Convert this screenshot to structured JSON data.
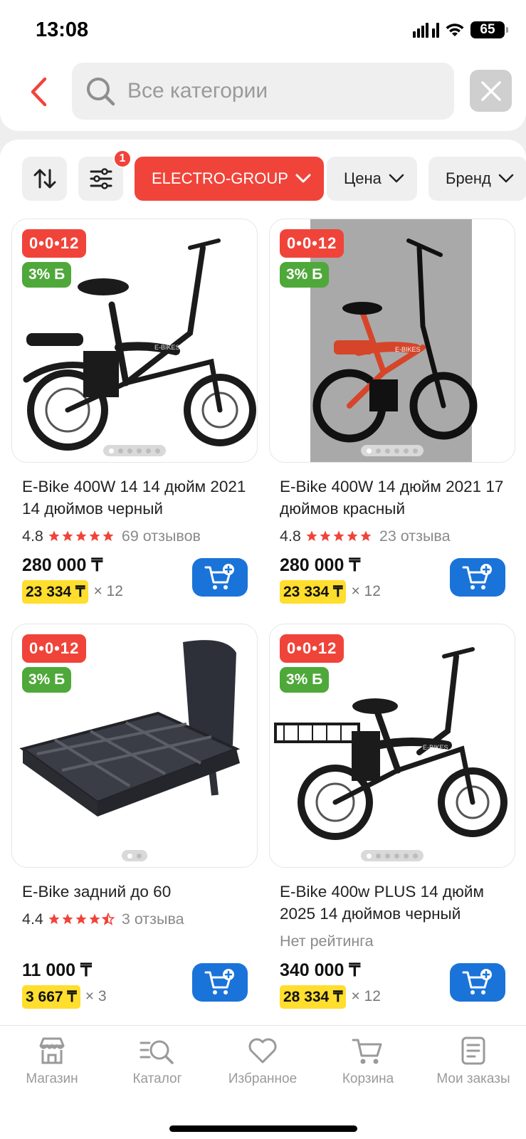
{
  "status": {
    "time": "13:08",
    "battery": "65"
  },
  "search": {
    "placeholder": "Все категории"
  },
  "filters": {
    "sort_badge": "1",
    "chips": [
      "ELECTRO-GROUP",
      "Цена",
      "Бренд"
    ]
  },
  "products": [
    {
      "installment": "0•0•12",
      "bonus": "3% Б",
      "title": "E-Bike 400W 14 14 дюйм 2021 14 дюймов черный",
      "rating": "4.8",
      "stars": 5,
      "reviews": "69 отзывов",
      "price": "280 000 ₸",
      "monthly": "23 334 ₸",
      "months": "× 12",
      "image": "black-folding-ebike",
      "image_dots": 6,
      "active_dot": 0
    },
    {
      "installment": "0•0•12",
      "bonus": "3% Б",
      "title": "E-Bike 400W 14 дюйм 2021 17 дюймов красный",
      "rating": "4.8",
      "stars": 5,
      "reviews": "23 отзыва",
      "price": "280 000 ₸",
      "monthly": "23 334 ₸",
      "months": "× 12",
      "image": "red-folding-ebike",
      "image_dots": 6,
      "active_dot": 0
    },
    {
      "installment": "0•0•12",
      "bonus": "3% Б",
      "title": "E-Bike задний до 60",
      "rating": "4.4",
      "stars": 4.5,
      "reviews": "3 отзыва",
      "price": "11 000 ₸",
      "monthly": "3 667 ₸",
      "months": "× 3",
      "image": "rear-rack-with-backrest",
      "image_dots": 2,
      "active_dot": 0
    },
    {
      "installment": "0•0•12",
      "bonus": "3% Б",
      "title": "E-Bike 400w PLUS 14 дюйм 2025 14 дюймов черный",
      "no_rating": "Нет рейтинга",
      "price": "340 000 ₸",
      "monthly": "28 334 ₸",
      "months": "× 12",
      "image": "black-ebike-with-rack",
      "image_dots": 6,
      "active_dot": 0
    }
  ],
  "nav": [
    {
      "label": "Магазин",
      "icon": "shop-icon"
    },
    {
      "label": "Каталог",
      "icon": "catalog-search-icon"
    },
    {
      "label": "Избранное",
      "icon": "heart-icon"
    },
    {
      "label": "Корзина",
      "icon": "cart-icon"
    },
    {
      "label": "Мои заказы",
      "icon": "orders-icon"
    }
  ],
  "colors": {
    "accent_red": "#f0443a",
    "bonus_green": "#4fa83a",
    "cart_blue": "#1a73d9",
    "monthly_yellow": "#ffde2e"
  }
}
